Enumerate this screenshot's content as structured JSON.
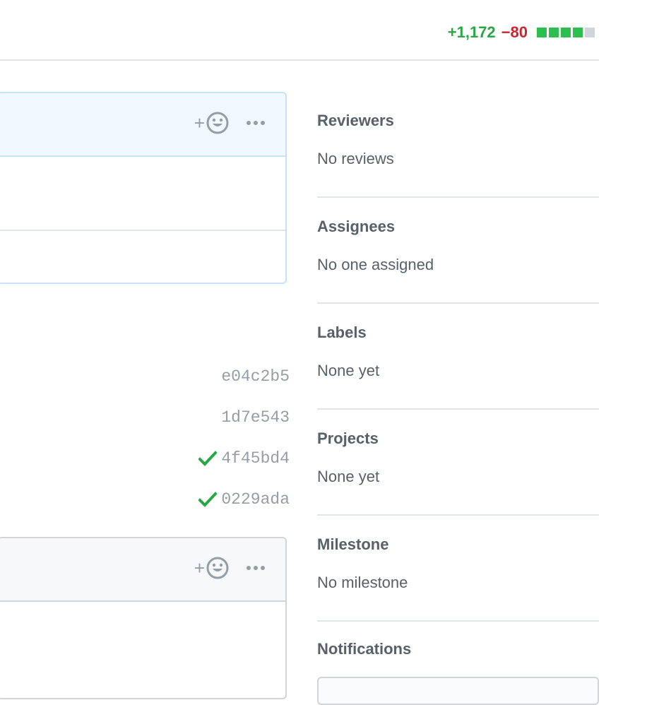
{
  "diffstat": {
    "additions": "+1,172",
    "deletions": "−80",
    "blocks": [
      "added",
      "added",
      "added",
      "added",
      "neutral"
    ]
  },
  "commits": [
    {
      "sha": "e04c2b5",
      "status": "none"
    },
    {
      "sha": "1d7e543",
      "status": "none"
    },
    {
      "sha": "4f45bd4",
      "status": "success"
    },
    {
      "sha": "0229ada",
      "status": "success"
    }
  ],
  "sidebar": {
    "reviewers": {
      "heading": "Reviewers",
      "value": "No reviews"
    },
    "assignees": {
      "heading": "Assignees",
      "value": "No one assigned"
    },
    "labels": {
      "heading": "Labels",
      "value": "None yet"
    },
    "projects": {
      "heading": "Projects",
      "value": "None yet"
    },
    "milestone": {
      "heading": "Milestone",
      "value": "No milestone"
    },
    "notifications": {
      "heading": "Notifications"
    }
  },
  "icons": {
    "reaction": "smiley-icon",
    "more": "kebab-horizontal-icon",
    "check": "check-icon"
  },
  "colors": {
    "addition": "#28a745",
    "deletion": "#cb2431",
    "neutral_block": "#d1d5da",
    "highlight_border": "#c8e1ff",
    "highlight_header": "#f1f8ff"
  }
}
